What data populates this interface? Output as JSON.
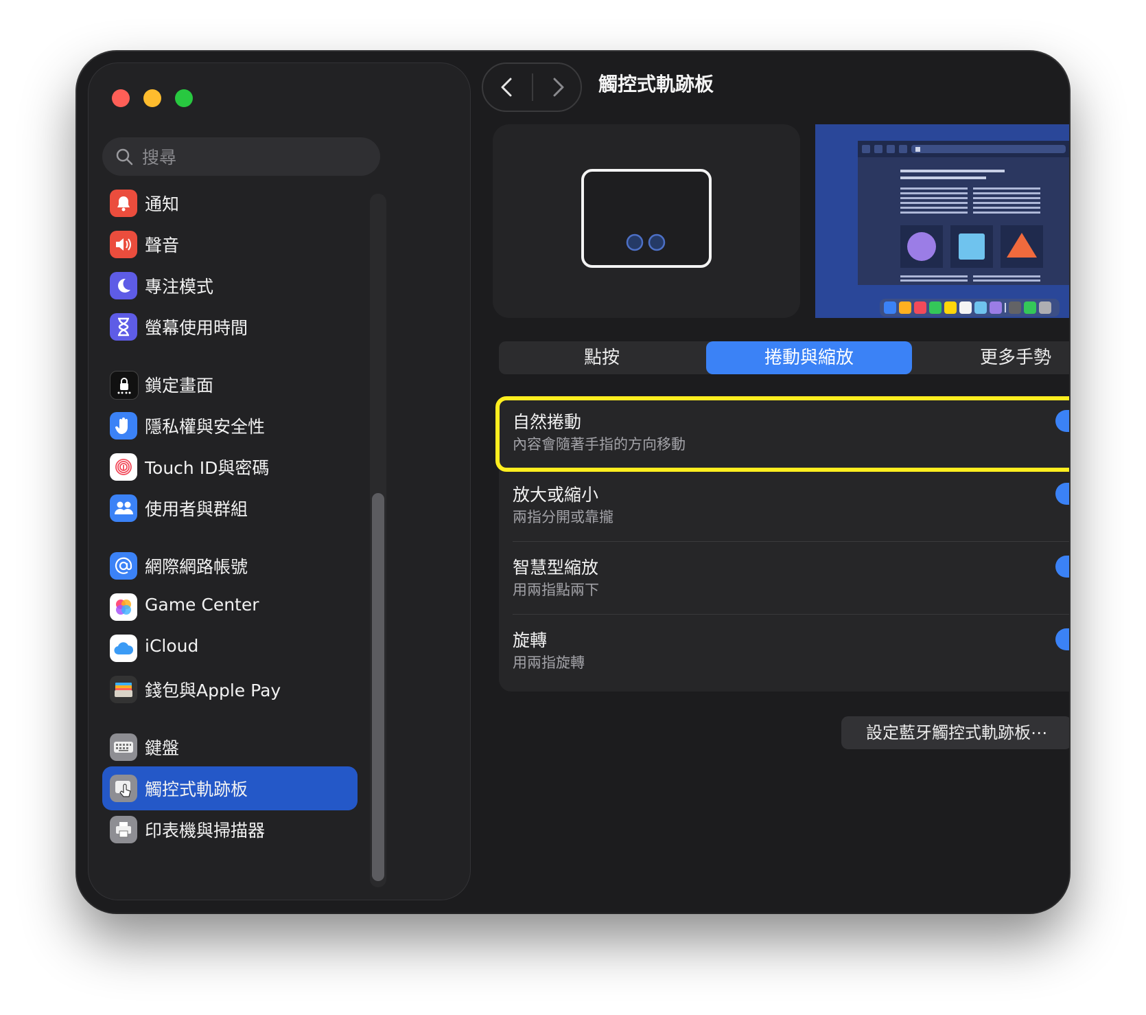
{
  "window": {
    "title": "觸控式軌跡板"
  },
  "search": {
    "placeholder": "搜尋"
  },
  "sidebar": {
    "items": [
      {
        "label": "通知",
        "icon": "bell-icon",
        "color": "#eb4d3d"
      },
      {
        "label": "聲音",
        "icon": "speaker-icon",
        "color": "#eb4d3d"
      },
      {
        "label": "專注模式",
        "icon": "moon-icon",
        "color": "#5e5ce6"
      },
      {
        "label": "螢幕使用時間",
        "icon": "hourglass-icon",
        "color": "#5e5ce6"
      },
      {
        "label": "鎖定畫面",
        "icon": "lock-icon",
        "color": "#111111"
      },
      {
        "label": "隱私權與安全性",
        "icon": "hand-icon",
        "color": "#3b82f6"
      },
      {
        "label": "Touch ID與密碼",
        "icon": "fingerprint-icon",
        "color": "#ffffff"
      },
      {
        "label": "使用者與群組",
        "icon": "users-icon",
        "color": "#3b82f6"
      },
      {
        "label": "網際網路帳號",
        "icon": "at-icon",
        "color": "#3b82f6"
      },
      {
        "label": "Game Center",
        "icon": "game-center-icon",
        "color": "#ffffff"
      },
      {
        "label": "iCloud",
        "icon": "cloud-icon",
        "color": "#ffffff"
      },
      {
        "label": "錢包與Apple Pay",
        "icon": "wallet-icon",
        "color": "#333333"
      },
      {
        "label": "鍵盤",
        "icon": "keyboard-icon",
        "color": "#8e8e93"
      },
      {
        "label": "觸控式軌跡板",
        "icon": "trackpad-icon",
        "color": "#8e8e93",
        "selected": true
      },
      {
        "label": "印表機與掃描器",
        "icon": "printer-icon",
        "color": "#8e8e93"
      }
    ]
  },
  "tabs": [
    {
      "label": "點按"
    },
    {
      "label": "捲動與縮放",
      "active": true
    },
    {
      "label": "更多手勢"
    }
  ],
  "settings": [
    {
      "title": "自然捲動",
      "subtitle": "內容會隨著手指的方向移動",
      "enabled": true,
      "highlighted": true
    },
    {
      "title": "放大或縮小",
      "subtitle": "兩指分開或靠攏",
      "enabled": true
    },
    {
      "title": "智慧型縮放",
      "subtitle": "用兩指點兩下",
      "enabled": true
    },
    {
      "title": "旋轉",
      "subtitle": "用兩指旋轉",
      "enabled": true
    }
  ],
  "footer": {
    "bluetooth_button": "設定藍牙觸控式軌跡板⋯",
    "help_button": "?"
  },
  "colors": {
    "accent": "#3b82f6",
    "selection": "#2458c8",
    "highlight": "#ffee1f",
    "window_bg": "#1c1c1e"
  }
}
